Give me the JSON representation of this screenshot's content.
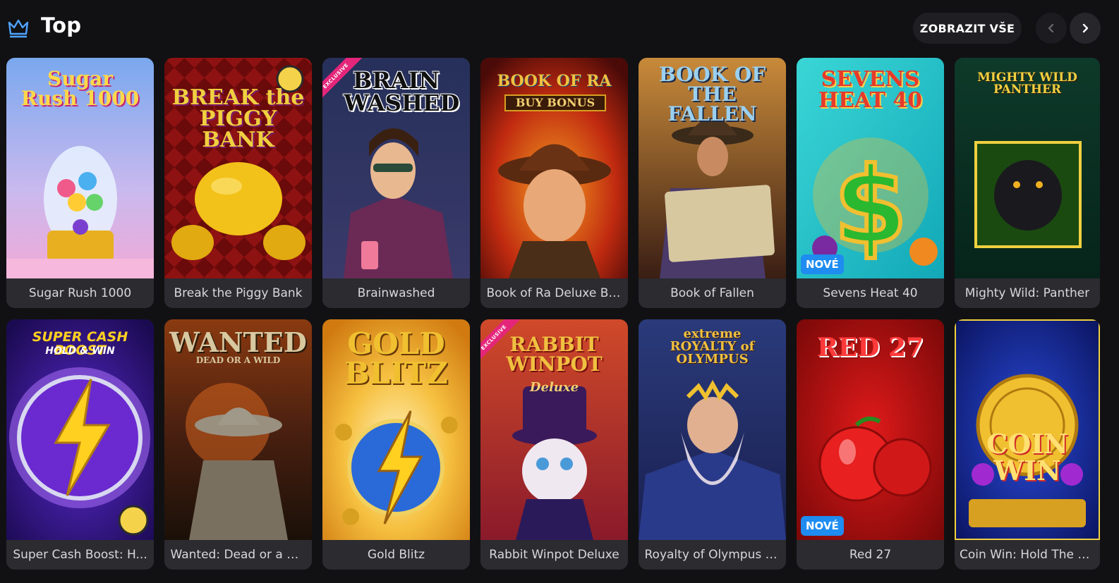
{
  "section": {
    "title": "Top",
    "show_all_label": "ZOBRAZIT VŠE"
  },
  "icons": {
    "section_icon": "crown-icon",
    "prev": "chevron-left-icon",
    "next": "chevron-right-icon"
  },
  "colors": {
    "background": "#111113",
    "card_label_bg": "#2b2b30",
    "new_badge": "#1e8cf0",
    "exclusive_ribbon": "#e4267a",
    "crown": "#4fa3ff"
  },
  "games": [
    {
      "name": "Sugar Rush 1000",
      "art_title": "Sugar Rush 1000",
      "badge": ""
    },
    {
      "name": "Break the Piggy Bank",
      "art_title": "BREAK the PIGGY BANK",
      "badge": ""
    },
    {
      "name": "Brainwashed",
      "art_title": "BRAIN WASHED",
      "badge": "",
      "ribbon": "EXCLUSIVE"
    },
    {
      "name": "Book of Ra Deluxe Bu...",
      "art_title": "BOOK OF RA",
      "art_subtitle": "BUY BONUS",
      "badge": ""
    },
    {
      "name": "Book of Fallen",
      "art_title": "BOOK OF THE FALLEN",
      "badge": ""
    },
    {
      "name": "Sevens Heat 40",
      "art_title": "SEVENS HEAT 40",
      "badge": "NOVÉ"
    },
    {
      "name": "Mighty Wild: Panther",
      "art_title": "MIGHTY WILD PANTHER",
      "badge": ""
    },
    {
      "name": "Super Cash Boost: H...",
      "art_title": "SUPER CASH BOOST",
      "art_subtitle": "HOLD & WIN",
      "badge": ""
    },
    {
      "name": "Wanted: Dead or a W...",
      "art_title": "WANTED",
      "art_subtitle": "DEAD OR A WILD",
      "badge": ""
    },
    {
      "name": "Gold Blitz",
      "art_title": "GOLD BLITZ",
      "badge": ""
    },
    {
      "name": "Rabbit Winpot Deluxe",
      "art_title": "RABBIT WINPOT",
      "art_subtitle": "Deluxe",
      "badge": "",
      "ribbon": "EXCLUSIVE"
    },
    {
      "name": "Royalty of Olympus E...",
      "art_title": "extreme ROYALTY of OLYMPUS",
      "badge": ""
    },
    {
      "name": "Red 27",
      "art_title": "RED 27",
      "badge": "NOVÉ"
    },
    {
      "name": "Coin Win: Hold The S...",
      "art_title": "COIN WIN",
      "badge": ""
    }
  ]
}
